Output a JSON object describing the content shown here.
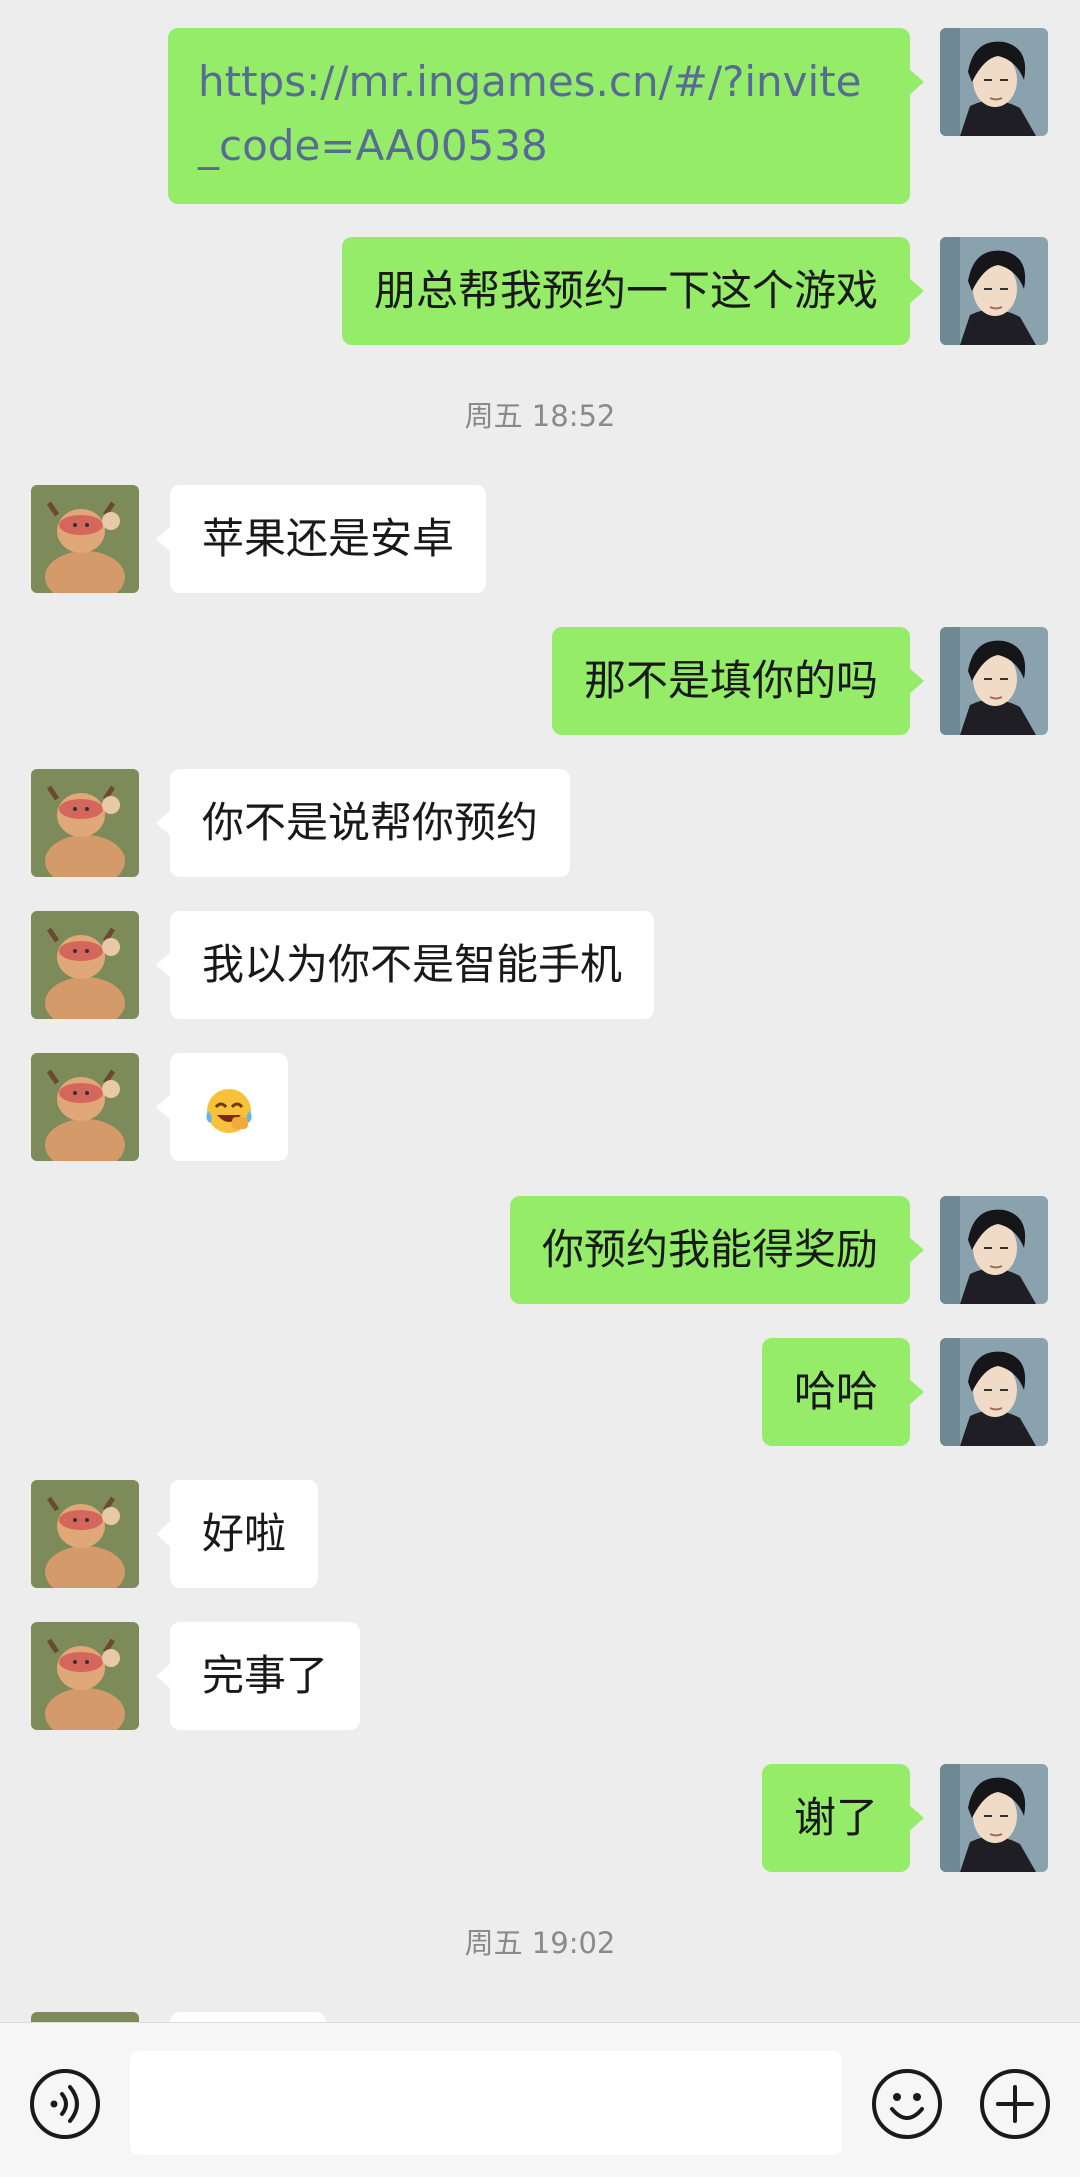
{
  "messages": [
    {
      "side": "right",
      "text": "https://mr.ingames.cn/#/?invite_code=AA00538",
      "kind": "link"
    },
    {
      "side": "right",
      "text": "朋总帮我预约一下这个游戏"
    },
    {
      "timestamp": "周五 18:52"
    },
    {
      "side": "left",
      "text": "苹果还是安卓"
    },
    {
      "side": "right",
      "text": "那不是填你的吗"
    },
    {
      "side": "left",
      "text": "你不是说帮你预约"
    },
    {
      "side": "left",
      "text": "我以为你不是智能手机"
    },
    {
      "side": "left",
      "emoji": "face-with-tears-of-joy"
    },
    {
      "side": "right",
      "text": "你预约我能得奖励"
    },
    {
      "side": "right",
      "text": "哈哈"
    },
    {
      "side": "left",
      "text": "好啦"
    },
    {
      "side": "left",
      "text": "完事了"
    },
    {
      "side": "right",
      "text": "谢了"
    },
    {
      "timestamp": "周五 19:02"
    }
  ],
  "input_bar": {
    "voice_icon": "voice-icon",
    "emoji_icon": "emoji-icon",
    "plus_icon": "plus-icon",
    "input_value": ""
  },
  "colors": {
    "background": "#ededed",
    "sent_bubble": "#95ec69",
    "received_bubble": "#ffffff",
    "link": "#576b95",
    "timestamp": "#8a8a8a"
  }
}
